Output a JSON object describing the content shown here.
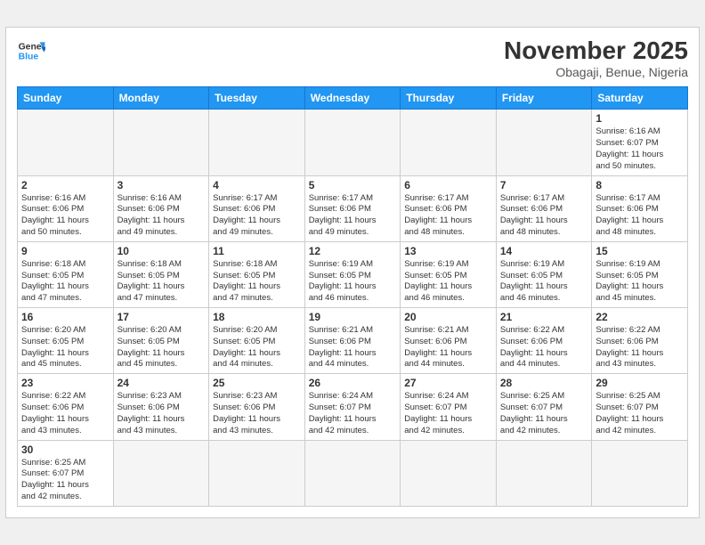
{
  "header": {
    "logo_general": "General",
    "logo_blue": "Blue",
    "month_title": "November 2025",
    "subtitle": "Obagaji, Benue, Nigeria"
  },
  "weekdays": [
    "Sunday",
    "Monday",
    "Tuesday",
    "Wednesday",
    "Thursday",
    "Friday",
    "Saturday"
  ],
  "weeks": [
    [
      {
        "day": "",
        "info": ""
      },
      {
        "day": "",
        "info": ""
      },
      {
        "day": "",
        "info": ""
      },
      {
        "day": "",
        "info": ""
      },
      {
        "day": "",
        "info": ""
      },
      {
        "day": "",
        "info": ""
      },
      {
        "day": "1",
        "info": "Sunrise: 6:16 AM\nSunset: 6:07 PM\nDaylight: 11 hours\nand 50 minutes."
      }
    ],
    [
      {
        "day": "2",
        "info": "Sunrise: 6:16 AM\nSunset: 6:06 PM\nDaylight: 11 hours\nand 50 minutes."
      },
      {
        "day": "3",
        "info": "Sunrise: 6:16 AM\nSunset: 6:06 PM\nDaylight: 11 hours\nand 49 minutes."
      },
      {
        "day": "4",
        "info": "Sunrise: 6:17 AM\nSunset: 6:06 PM\nDaylight: 11 hours\nand 49 minutes."
      },
      {
        "day": "5",
        "info": "Sunrise: 6:17 AM\nSunset: 6:06 PM\nDaylight: 11 hours\nand 49 minutes."
      },
      {
        "day": "6",
        "info": "Sunrise: 6:17 AM\nSunset: 6:06 PM\nDaylight: 11 hours\nand 48 minutes."
      },
      {
        "day": "7",
        "info": "Sunrise: 6:17 AM\nSunset: 6:06 PM\nDaylight: 11 hours\nand 48 minutes."
      },
      {
        "day": "8",
        "info": "Sunrise: 6:17 AM\nSunset: 6:06 PM\nDaylight: 11 hours\nand 48 minutes."
      }
    ],
    [
      {
        "day": "9",
        "info": "Sunrise: 6:18 AM\nSunset: 6:05 PM\nDaylight: 11 hours\nand 47 minutes."
      },
      {
        "day": "10",
        "info": "Sunrise: 6:18 AM\nSunset: 6:05 PM\nDaylight: 11 hours\nand 47 minutes."
      },
      {
        "day": "11",
        "info": "Sunrise: 6:18 AM\nSunset: 6:05 PM\nDaylight: 11 hours\nand 47 minutes."
      },
      {
        "day": "12",
        "info": "Sunrise: 6:19 AM\nSunset: 6:05 PM\nDaylight: 11 hours\nand 46 minutes."
      },
      {
        "day": "13",
        "info": "Sunrise: 6:19 AM\nSunset: 6:05 PM\nDaylight: 11 hours\nand 46 minutes."
      },
      {
        "day": "14",
        "info": "Sunrise: 6:19 AM\nSunset: 6:05 PM\nDaylight: 11 hours\nand 46 minutes."
      },
      {
        "day": "15",
        "info": "Sunrise: 6:19 AM\nSunset: 6:05 PM\nDaylight: 11 hours\nand 45 minutes."
      }
    ],
    [
      {
        "day": "16",
        "info": "Sunrise: 6:20 AM\nSunset: 6:05 PM\nDaylight: 11 hours\nand 45 minutes."
      },
      {
        "day": "17",
        "info": "Sunrise: 6:20 AM\nSunset: 6:05 PM\nDaylight: 11 hours\nand 45 minutes."
      },
      {
        "day": "18",
        "info": "Sunrise: 6:20 AM\nSunset: 6:05 PM\nDaylight: 11 hours\nand 44 minutes."
      },
      {
        "day": "19",
        "info": "Sunrise: 6:21 AM\nSunset: 6:06 PM\nDaylight: 11 hours\nand 44 minutes."
      },
      {
        "day": "20",
        "info": "Sunrise: 6:21 AM\nSunset: 6:06 PM\nDaylight: 11 hours\nand 44 minutes."
      },
      {
        "day": "21",
        "info": "Sunrise: 6:22 AM\nSunset: 6:06 PM\nDaylight: 11 hours\nand 44 minutes."
      },
      {
        "day": "22",
        "info": "Sunrise: 6:22 AM\nSunset: 6:06 PM\nDaylight: 11 hours\nand 43 minutes."
      }
    ],
    [
      {
        "day": "23",
        "info": "Sunrise: 6:22 AM\nSunset: 6:06 PM\nDaylight: 11 hours\nand 43 minutes."
      },
      {
        "day": "24",
        "info": "Sunrise: 6:23 AM\nSunset: 6:06 PM\nDaylight: 11 hours\nand 43 minutes."
      },
      {
        "day": "25",
        "info": "Sunrise: 6:23 AM\nSunset: 6:06 PM\nDaylight: 11 hours\nand 43 minutes."
      },
      {
        "day": "26",
        "info": "Sunrise: 6:24 AM\nSunset: 6:07 PM\nDaylight: 11 hours\nand 42 minutes."
      },
      {
        "day": "27",
        "info": "Sunrise: 6:24 AM\nSunset: 6:07 PM\nDaylight: 11 hours\nand 42 minutes."
      },
      {
        "day": "28",
        "info": "Sunrise: 6:25 AM\nSunset: 6:07 PM\nDaylight: 11 hours\nand 42 minutes."
      },
      {
        "day": "29",
        "info": "Sunrise: 6:25 AM\nSunset: 6:07 PM\nDaylight: 11 hours\nand 42 minutes."
      }
    ],
    [
      {
        "day": "30",
        "info": "Sunrise: 6:25 AM\nSunset: 6:07 PM\nDaylight: 11 hours\nand 42 minutes."
      },
      {
        "day": "",
        "info": ""
      },
      {
        "day": "",
        "info": ""
      },
      {
        "day": "",
        "info": ""
      },
      {
        "day": "",
        "info": ""
      },
      {
        "day": "",
        "info": ""
      },
      {
        "day": "",
        "info": ""
      }
    ]
  ]
}
